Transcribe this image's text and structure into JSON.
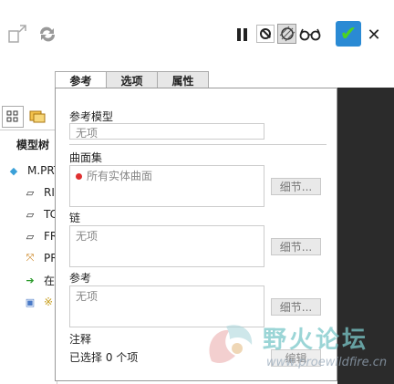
{
  "toolbar": {
    "icons": [
      "move-icon",
      "regenerate-icon",
      "pause-icon",
      "no-preview-icon",
      "preview-icon",
      "glasses-icon",
      "ok-checkmark-icon",
      "close-icon"
    ],
    "accent_color": "#2a8ad4",
    "check_color": "#4cd321"
  },
  "tabs": [
    {
      "label": "参考",
      "active": true
    },
    {
      "label": "选项",
      "active": false
    },
    {
      "label": "属性",
      "active": false
    }
  ],
  "dialog": {
    "ref_model": {
      "label": "参考模型",
      "value": "无项"
    },
    "surface_set": {
      "label": "曲面集",
      "item": "所有实体曲面",
      "detail_label": "细节..."
    },
    "chain": {
      "label": "链",
      "value": "无项",
      "detail_label": "细节..."
    },
    "reference": {
      "label": "参考",
      "value": "无项",
      "detail_label": "细节..."
    },
    "note": {
      "label": "注释",
      "status": "已选择 0 个项",
      "edit_label": "编辑"
    }
  },
  "model_tree": {
    "title": "模型树",
    "rows": [
      {
        "text": "M.PRT",
        "icon": "part-icon"
      },
      {
        "text": "RI",
        "icon": "datum-plane-icon"
      },
      {
        "text": "TC",
        "icon": "datum-plane-icon"
      },
      {
        "text": "FR",
        "icon": "datum-plane-icon"
      },
      {
        "text": "PR",
        "icon": "csys-icon"
      },
      {
        "text": "在",
        "icon": "insert-arrow-icon"
      },
      {
        "text": "※",
        "icon": "feature-icon"
      }
    ]
  },
  "watermark": {
    "title": "野火论坛",
    "url": "www.proewildfire.cn"
  }
}
